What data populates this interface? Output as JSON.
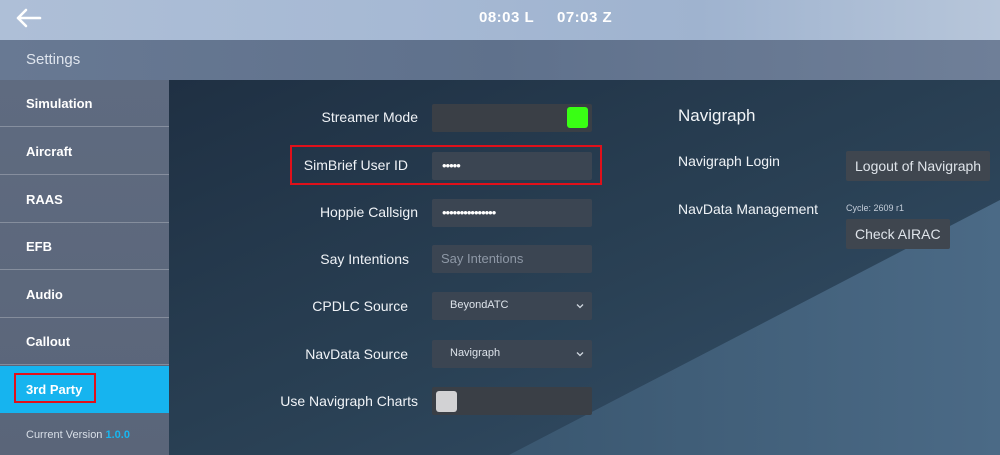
{
  "header": {
    "local_time": "08:03 L",
    "zulu_time": "07:03 Z",
    "back_icon": "arrow-left-icon"
  },
  "settings": {
    "title": "Settings"
  },
  "sidebar": {
    "items": [
      {
        "label": "Simulation"
      },
      {
        "label": "Aircraft"
      },
      {
        "label": "RAAS"
      },
      {
        "label": "EFB"
      },
      {
        "label": "Audio"
      },
      {
        "label": "Callout"
      },
      {
        "label": "3rd Party"
      }
    ],
    "active": "3rd Party",
    "version_label": "Current Version",
    "version_number": "1.0.0"
  },
  "form": {
    "streamer_mode": {
      "label": "Streamer Mode",
      "enabled": true
    },
    "simbrief": {
      "label": "SimBrief User ID",
      "value": "•••••"
    },
    "hoppie": {
      "label": "Hoppie Callsign",
      "value": "•••••••••••••••"
    },
    "say_intentions": {
      "label": "Say Intentions",
      "placeholder": "Say Intentions",
      "value": ""
    },
    "cpdlc": {
      "label": "CPDLC Source",
      "value": "BeyondATC"
    },
    "navdata_source": {
      "label": "NavData Source",
      "value": "Navigraph"
    },
    "navigraph_charts": {
      "label": "Use Navigraph Charts",
      "enabled": false
    }
  },
  "navigraph": {
    "title": "Navigraph",
    "login_label": "Navigraph Login",
    "logout_button": "Logout of Navigraph",
    "navdata_label": "NavData Management",
    "cycle": "Cycle: 2609 r1",
    "check_button": "Check AIRAC"
  },
  "colors": {
    "accent": "#16b4ef",
    "toggle_on": "#39ff14",
    "highlight": "#e0101a"
  }
}
